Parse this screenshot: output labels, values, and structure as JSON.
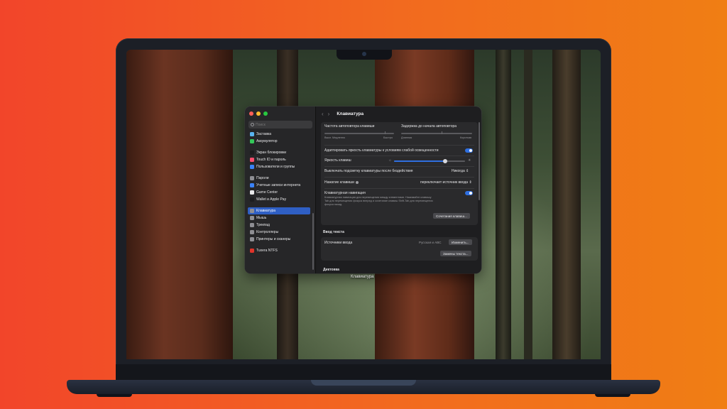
{
  "window": {
    "title": "Клавиатура",
    "search_placeholder": "Поиск"
  },
  "sidebar": {
    "items": [
      {
        "label": "Заставка",
        "icon": "screensaver-icon",
        "color": "#5ab4f0"
      },
      {
        "label": "Аккумулятор",
        "icon": "battery-icon",
        "color": "#34c759"
      },
      {
        "label": "Экран блокировки",
        "icon": "lock-screen-icon",
        "color": "#1c1c1e"
      },
      {
        "label": "Touch ID и пароль",
        "icon": "fingerprint-icon",
        "color": "#ff4d6d"
      },
      {
        "label": "Пользователи и группы",
        "icon": "users-icon",
        "color": "#3a82f7"
      },
      {
        "label": "Пароли",
        "icon": "key-icon",
        "color": "#8e8e93"
      },
      {
        "label": "Учетные записи интернета",
        "icon": "at-icon",
        "color": "#3a82f7"
      },
      {
        "label": "Game Center",
        "icon": "game-center-icon",
        "color": "#e8e8ea"
      },
      {
        "label": "Wallet и Apple Pay",
        "icon": "wallet-icon",
        "color": "#1c1c1e"
      },
      {
        "label": "Клавиатура",
        "icon": "keyboard-icon",
        "color": "#8e8e93",
        "selected": true
      },
      {
        "label": "Мышь",
        "icon": "mouse-icon",
        "color": "#8e8e93"
      },
      {
        "label": "Трекпад",
        "icon": "trackpad-icon",
        "color": "#8e8e93"
      },
      {
        "label": "Контроллеры",
        "icon": "gamepad-icon",
        "color": "#8e8e93"
      },
      {
        "label": "Принтеры и сканеры",
        "icon": "printer-icon",
        "color": "#8e8e93"
      },
      {
        "label": "Tuxera NTFS",
        "icon": "tuxera-icon",
        "color": "#e0342a"
      }
    ]
  },
  "keyboard": {
    "repeat_rate_label": "Частота автоповтора клавиши",
    "repeat_delay_label": "Задержка до начала автоповтора",
    "repeat_rate_min": "Выкл.",
    "repeat_rate_slow": "Медленно",
    "repeat_rate_fast": "Быстро",
    "repeat_delay_long": "Длинная",
    "repeat_delay_short": "Короткая",
    "adjust_brightness_label": "Адаптировать яркость клавиатуры к условиям слабой освещенности",
    "brightness_label": "Яркость клавиш",
    "brightness_value": 0.72,
    "backlight_off_label": "Выключать подсветку клавиатуры после бездействия",
    "backlight_off_value": "Никогда",
    "press_key_label": "Нажатие клавиши",
    "press_key_value": "переключает источник ввода",
    "nav_label": "Клавиатурная навигация",
    "nav_desc_1": "Клавиатурная навигация для перемещения между элементами. Нажимайте клавишу",
    "nav_desc_2": "Tab для перемещения фокуса вперед и сочетание клавиш Shift-Tab для перемещения",
    "nav_desc_3": "фокуса назад.",
    "shortcuts_button": "Сочетания клавиш..."
  },
  "text_input": {
    "section_title": "Ввод текста",
    "sources_label": "Источники ввода",
    "sources_value": "Русская и ABC",
    "edit_button": "Изменить...",
    "replacements_button": "Замены текста..."
  },
  "dictation": {
    "section_title": "Диктовка"
  },
  "dock_label": "Клавиатура"
}
